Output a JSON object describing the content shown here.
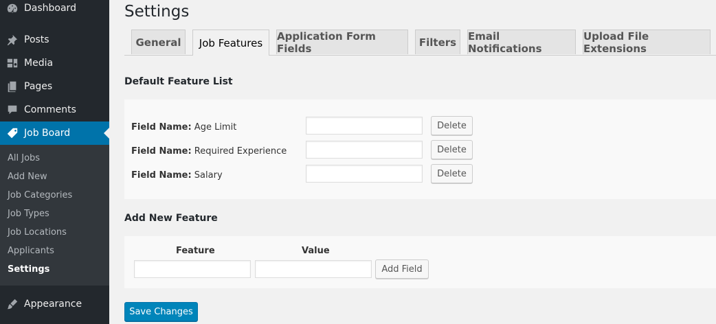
{
  "page": {
    "title": "Settings"
  },
  "sidebar": {
    "items": [
      {
        "label": "Dashboard",
        "icon": "dashboard-icon"
      },
      {
        "label": "Posts",
        "icon": "pin-icon"
      },
      {
        "label": "Media",
        "icon": "media-icon"
      },
      {
        "label": "Pages",
        "icon": "pages-icon"
      },
      {
        "label": "Comments",
        "icon": "comment-icon"
      },
      {
        "label": "Job Board",
        "icon": "tag-icon",
        "active": true
      },
      {
        "label": "Appearance",
        "icon": "brush-icon"
      }
    ],
    "submenu": [
      {
        "label": "All Jobs"
      },
      {
        "label": "Add New"
      },
      {
        "label": "Job Categories"
      },
      {
        "label": "Job Types"
      },
      {
        "label": "Job Locations"
      },
      {
        "label": "Applicants"
      },
      {
        "label": "Settings",
        "current": true
      }
    ]
  },
  "tabs": [
    {
      "label": "General"
    },
    {
      "label": "Job Features",
      "active": true
    },
    {
      "label": "Application Form Fields"
    },
    {
      "label": "Filters"
    },
    {
      "label": "Email Notifications"
    },
    {
      "label": "Upload File Extensions"
    }
  ],
  "default_features": {
    "title": "Default Feature List",
    "field_prefix": "Field Name:",
    "delete_label": "Delete",
    "rows": [
      {
        "name": "Age Limit",
        "value": ""
      },
      {
        "name": "Required Experience",
        "value": ""
      },
      {
        "name": "Salary",
        "value": ""
      }
    ]
  },
  "add_feature": {
    "title": "Add New Feature",
    "feature_header": "Feature",
    "value_header": "Value",
    "feature_value": "",
    "value_value": "",
    "add_label": "Add Field"
  },
  "save_label": "Save Changes",
  "colors": {
    "accent": "#0073aa",
    "sidebar_bg": "#23282d",
    "button_primary": "#0085ba"
  }
}
